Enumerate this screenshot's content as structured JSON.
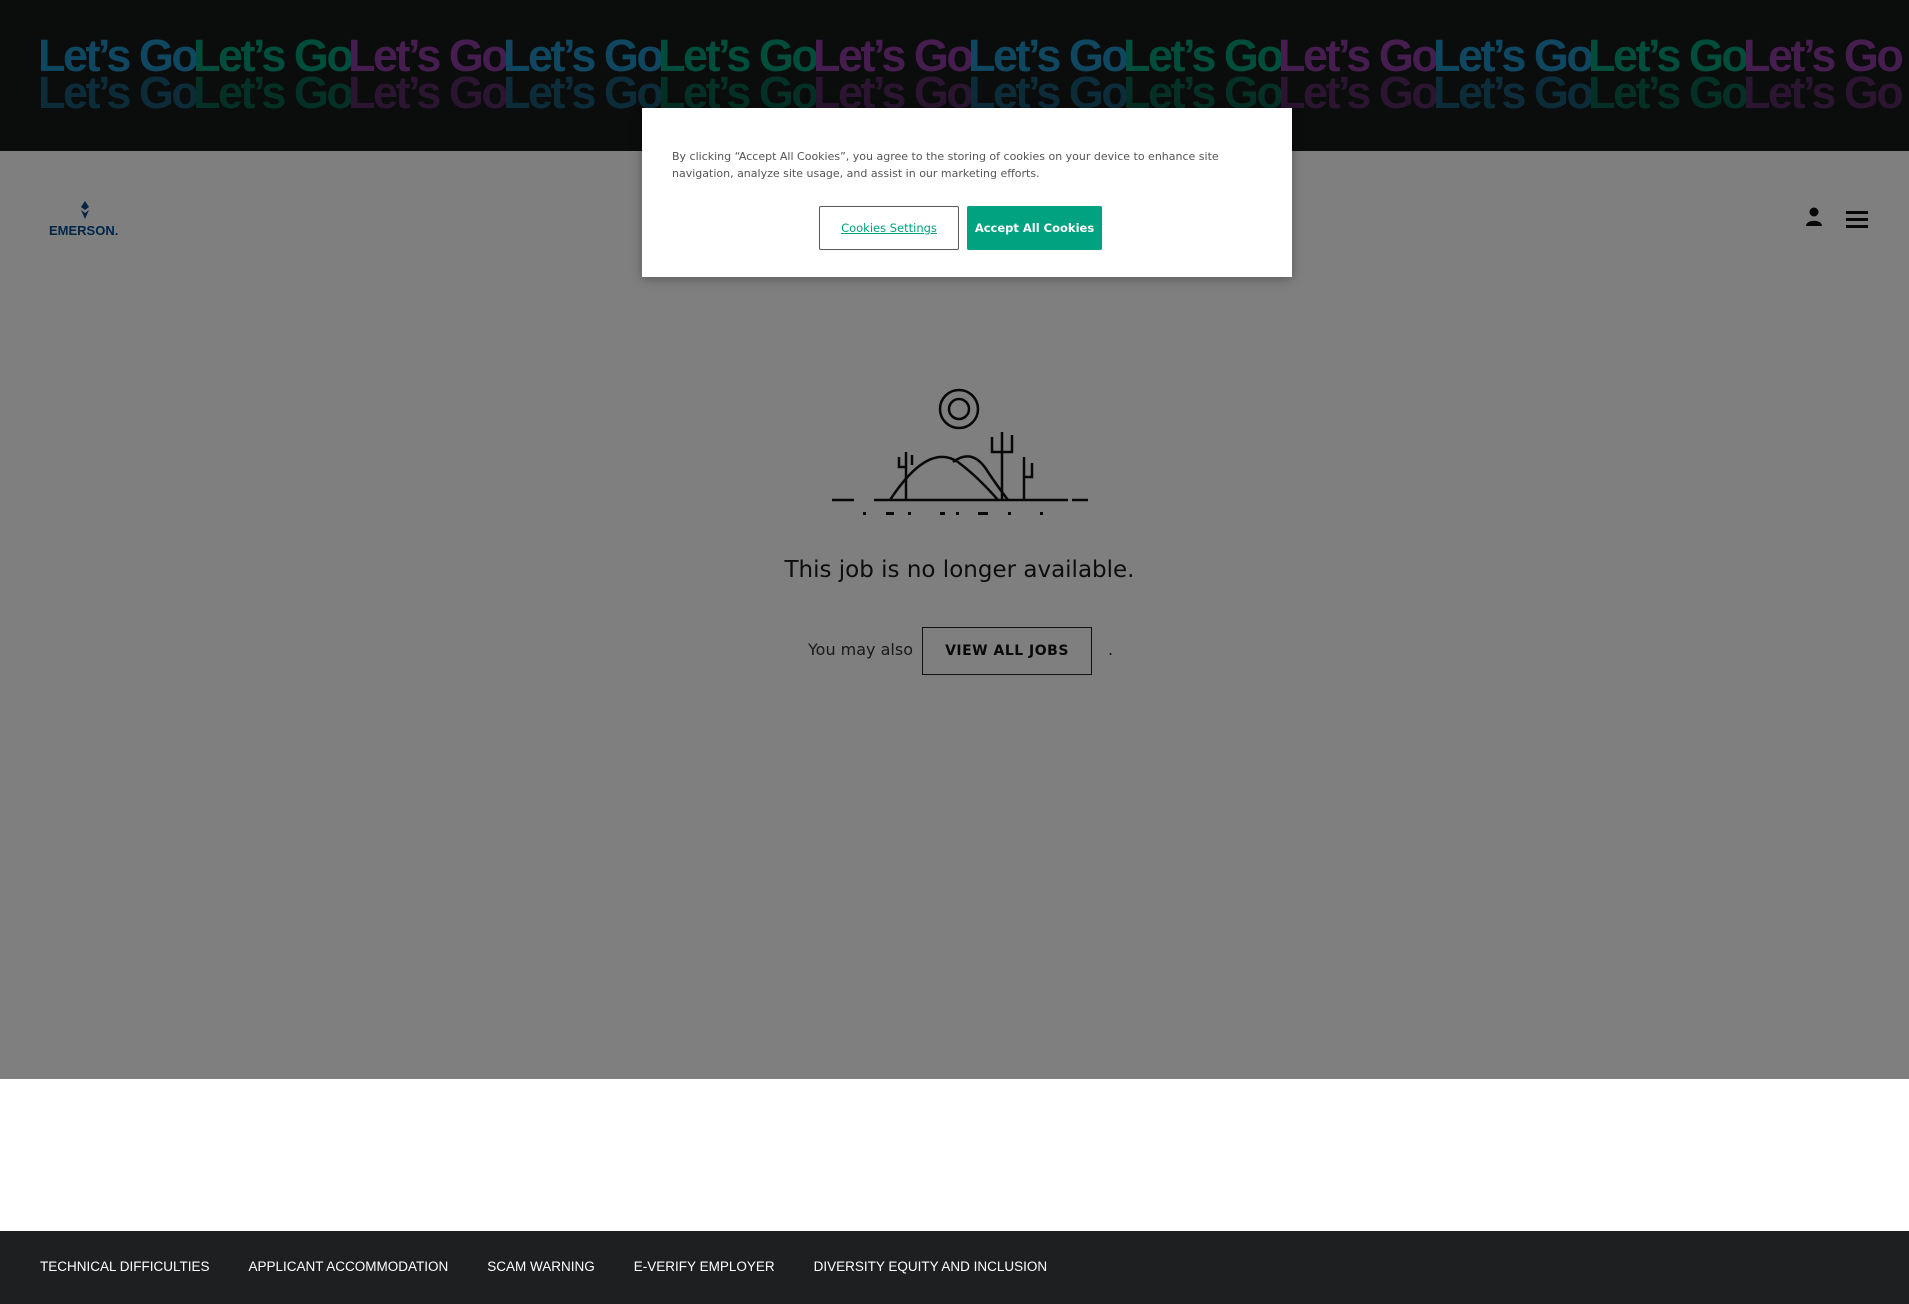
{
  "banner": {
    "phrase": "Let’s Go",
    "colors": [
      "#1f8fc1",
      "#009b76",
      "#8b3a9c",
      "#1f8fc1",
      "#009b76",
      "#8b3a9c",
      "#1f8fc1",
      "#009b76",
      "#8b3a9c",
      "#1f8fc1",
      "#009b76",
      "#8b3a9c"
    ]
  },
  "header": {
    "logo_text": "EMERSON.",
    "user_icon": "user-icon",
    "menu_icon": "hamburger-menu-icon"
  },
  "main": {
    "illustration": "desert-landscape-illustration",
    "message": "This job is no longer available.",
    "also_text": "You may also",
    "view_all_label": "VIEW ALL JOBS",
    "period": "."
  },
  "cookie": {
    "text": "By clicking “Accept All Cookies”, you agree to the storing of cookies on your device to enhance site navigation, analyze site usage, and assist in our marketing efforts.",
    "settings_label": "Cookies Settings",
    "accept_label": "Accept All Cookies",
    "accent_color": "#00a27f"
  },
  "footer": {
    "links": [
      "TECHNICAL DIFFICULTIES",
      "APPLICANT ACCOMMODATION",
      "SCAM WARNING",
      "E-VERIFY EMPLOYER",
      "DIVERSITY EQUITY AND INCLUSION"
    ]
  }
}
